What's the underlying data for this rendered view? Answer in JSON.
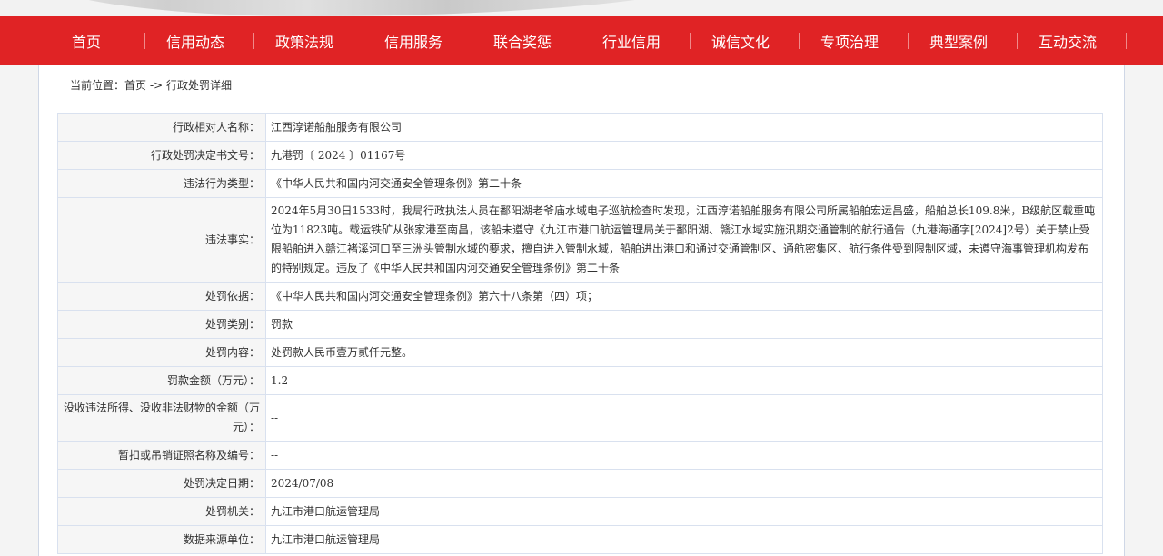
{
  "nav": {
    "items": [
      "首页",
      "信用动态",
      "政策法规",
      "信用服务",
      "联合奖惩",
      "行业信用",
      "诚信文化",
      "专项治理",
      "典型案例",
      "互动交流"
    ],
    "bg_color": "#e02325"
  },
  "breadcrumb": {
    "prefix": "当前位置：",
    "home": "首页",
    "separator": " -> ",
    "current": "行政处罚详细"
  },
  "detail": {
    "rows": [
      {
        "label": "行政相对人名称：",
        "value": "江西淳诺船舶服务有限公司"
      },
      {
        "label": "行政处罚决定书文号：",
        "value": "九港罚〔 2024 〕01167号"
      },
      {
        "label": "违法行为类型：",
        "value": "《中华人民共和国内河交通安全管理条例》第二十条"
      },
      {
        "label": "违法事实：",
        "value": "2024年5月30日1533时，我局行政执法人员在鄱阳湖老爷庙水域电子巡航检查时发现，江西淳诺船舶服务有限公司所属船舶宏运昌盛，船舶总长109.8米，B级航区载重吨位为11823吨。载运铁矿从张家港至南昌，该船未遵守《九江市港口航运管理局关于鄱阳湖、赣江水域实施汛期交通管制的航行通告（九港海通字[2024]2号）关于禁止受限船舶进入赣江褚溪河口至三洲头管制水域的要求，擅自进入管制水域，船舶进出港口和通过交通管制区、通航密集区、航行条件受到限制区域，未遵守海事管理机构发布的特别规定。违反了《中华人民共和国内河交通安全管理条例》第二十条"
      },
      {
        "label": "处罚依据：",
        "value": "《中华人民共和国内河交通安全管理条例》第六十八条第（四）项；"
      },
      {
        "label": "处罚类别：",
        "value": "罚款"
      },
      {
        "label": "处罚内容：",
        "value": "处罚款人民币壹万贰仟元整。"
      },
      {
        "label": "罚款金额（万元）：",
        "value": "1.2"
      },
      {
        "label": "没收违法所得、没收非法财物的金额（万元）：",
        "value": "--"
      },
      {
        "label": "暂扣或吊销证照名称及编号：",
        "value": "--"
      },
      {
        "label": "处罚决定日期：",
        "value": "2024/07/08"
      },
      {
        "label": "处罚机关：",
        "value": "九江市港口航运管理局"
      },
      {
        "label": "数据来源单位：",
        "value": "九江市港口航运管理局"
      }
    ]
  }
}
